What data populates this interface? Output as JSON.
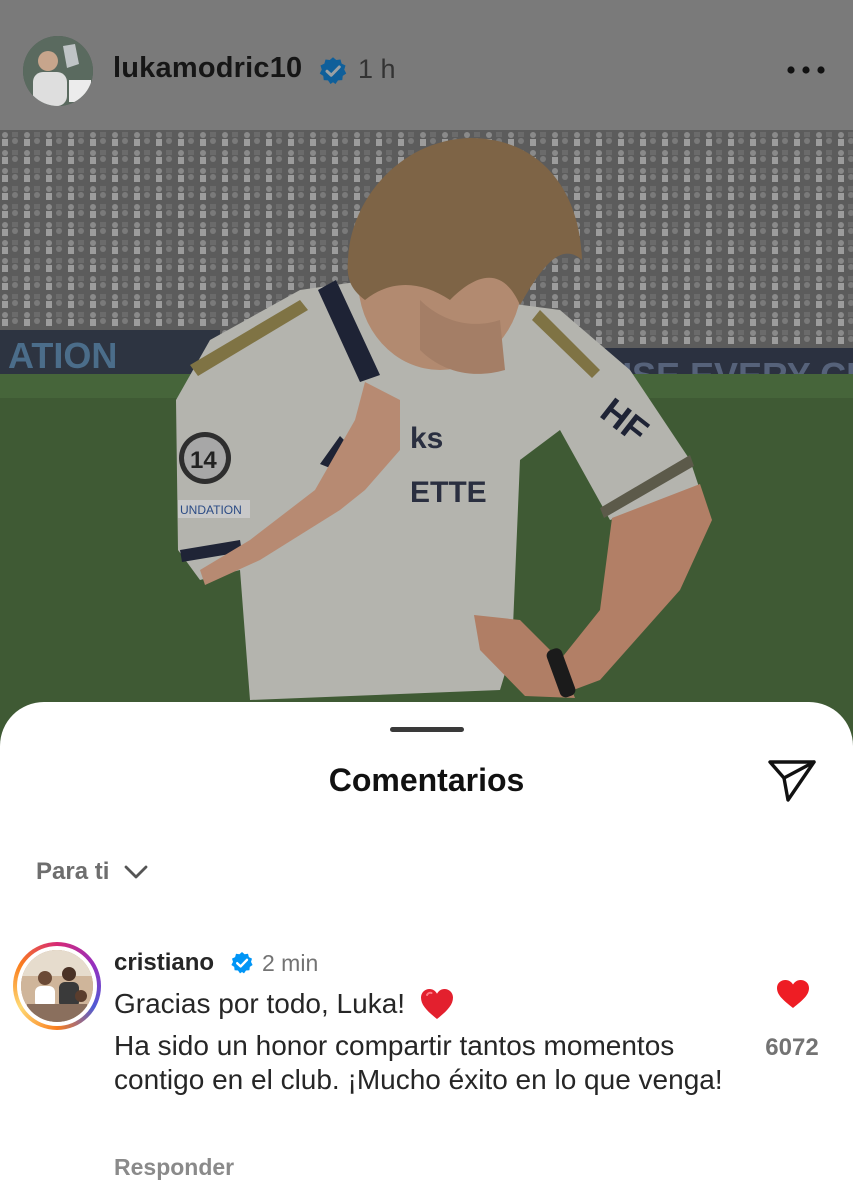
{
  "post": {
    "username": "lukamodric10",
    "time": "1 h",
    "icons": {
      "verified": "verified-badge-icon",
      "more": "more-options-icon"
    },
    "photo_banner_left": "ATION",
    "photo_banner_right": "USE EVERY CH",
    "photo_badge": "14",
    "photo_foundation": "UNDATION"
  },
  "sheet": {
    "title": "Comentarios",
    "share_icon": "send-icon",
    "filter_label": "Para ti",
    "filter_icon": "chevron-down-icon"
  },
  "comment": {
    "username": "cristiano",
    "time": "2 min",
    "line1": "Gracias por todo, Luka!",
    "line1_emoji": "red-heart-emoji",
    "line2": "Ha sido un honor compartir tantos momentos contigo en el club. ¡Mucho éxito en lo que venga!",
    "reply_label": "Responder",
    "like_count": "6072",
    "like_icon": "heart-filled-icon",
    "colors": {
      "like": "#ee1d24",
      "verified": "#0095f6"
    }
  }
}
